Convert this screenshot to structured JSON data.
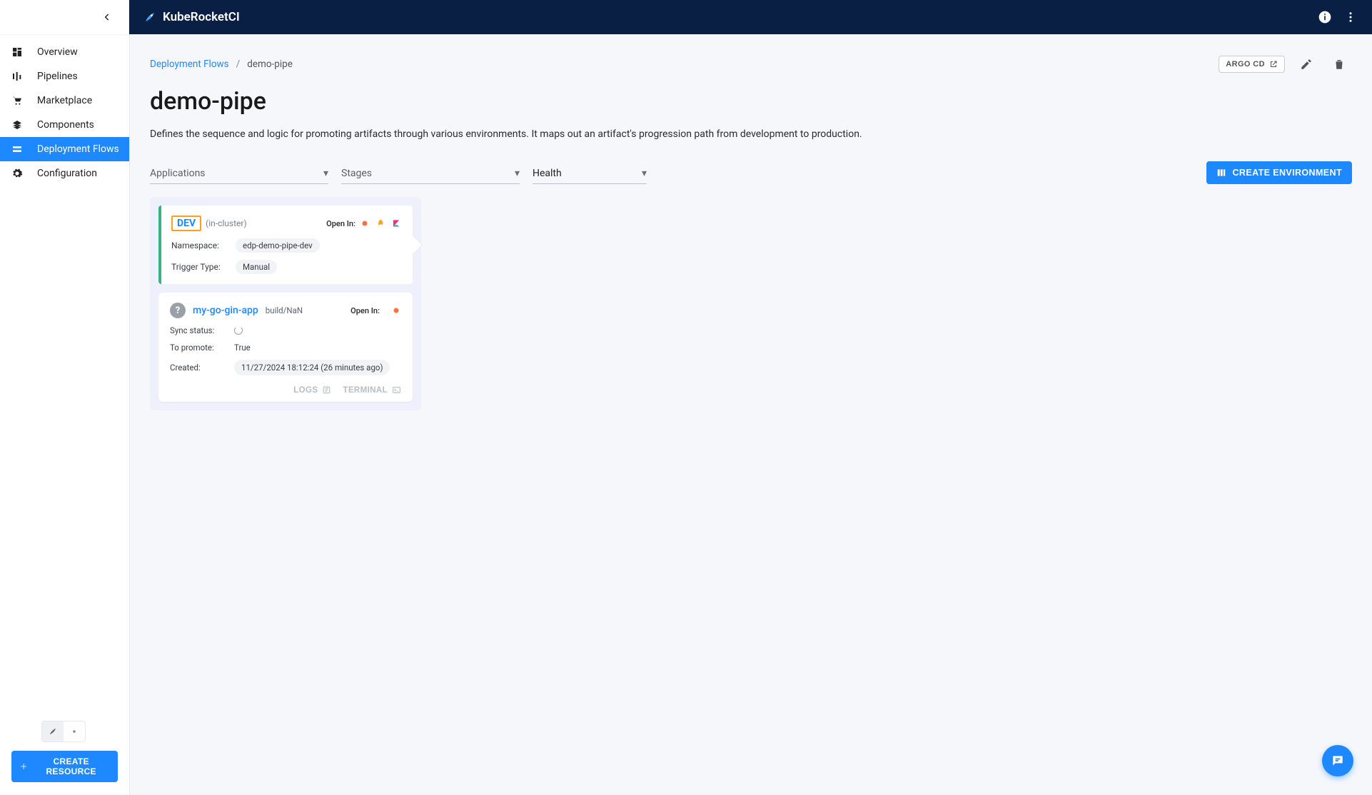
{
  "brand": {
    "name": "KubeRocketCI"
  },
  "sidebar": {
    "items": [
      {
        "label": "Overview",
        "icon": "dashboard"
      },
      {
        "label": "Pipelines",
        "icon": "pipelines"
      },
      {
        "label": "Marketplace",
        "icon": "cart"
      },
      {
        "label": "Components",
        "icon": "layers"
      },
      {
        "label": "Deployment Flows",
        "icon": "flows",
        "active": true
      },
      {
        "label": "Configuration",
        "icon": "gear"
      }
    ],
    "create_resource_label": "CREATE RESOURCE"
  },
  "breadcrumbs": {
    "parent": "Deployment Flows",
    "current": "demo-pipe"
  },
  "page": {
    "title": "demo-pipe",
    "description": "Defines the sequence and logic for promoting artifacts through various environments. It maps out an artifact's progression path from development to production."
  },
  "actions": {
    "argo_label": "ARGO CD",
    "create_env_label": "CREATE ENVIRONMENT"
  },
  "filters": {
    "applications_label": "Applications",
    "stages_label": "Stages",
    "health_label": "Health"
  },
  "stage": {
    "name": "DEV",
    "cluster": "(in-cluster)",
    "open_in_label": "Open In:",
    "namespace_label": "Namespace:",
    "namespace_value": "edp-demo-pipe-dev",
    "trigger_label": "Trigger Type:",
    "trigger_value": "Manual"
  },
  "appcard": {
    "name": "my-go-gin-app",
    "build": "build/NaN",
    "open_in_label": "Open In:",
    "sync_label": "Sync status:",
    "promote_label": "To promote:",
    "promote_value": "True",
    "created_label": "Created:",
    "created_value": "11/27/2024 18:12:24 (26 minutes ago)",
    "logs_label": "LOGS",
    "terminal_label": "TERMINAL"
  }
}
